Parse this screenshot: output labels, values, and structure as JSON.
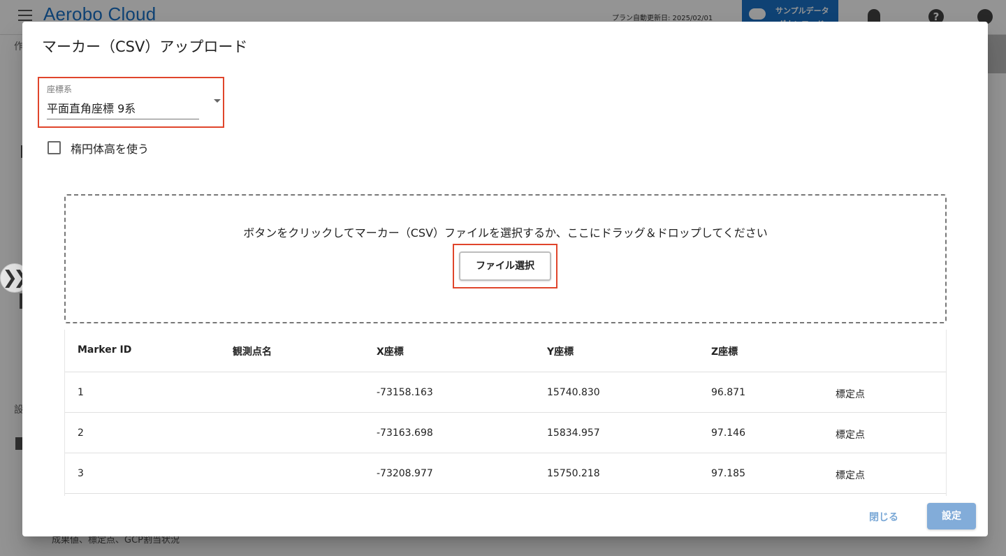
{
  "app": {
    "title": "Aerobo Cloud",
    "plan_date": "プラン自動更新日: 2025/02/01",
    "sample_button_line1": "サンプルデータ",
    "sample_button_line2": "ダウンロード",
    "bottom_text": "成果値、標定点、GCP割当状況"
  },
  "dialog": {
    "title": "マーカー（CSV）アップロード",
    "coord_select": {
      "label": "座標系",
      "value": "平面直角座標 9系"
    },
    "checkbox_label": "楕円体高を使う",
    "dropzone_text": "ボタンをクリックしてマーカー（CSV）ファイルを選択するか、ここにドラッグ＆ドロップしてください",
    "file_button": "ファイル選択",
    "table": {
      "headers": [
        "Marker ID",
        "観測点名",
        "X座標",
        "Y座標",
        "Z座標",
        ""
      ],
      "rows": [
        [
          "1",
          "",
          "-73158.163",
          "15740.830",
          "96.871",
          "標定点"
        ],
        [
          "2",
          "",
          "-73163.698",
          "15834.957",
          "97.146",
          "標定点"
        ],
        [
          "3",
          "",
          "-73208.977",
          "15750.218",
          "97.185",
          "標定点"
        ]
      ]
    },
    "close_button": "閉じる",
    "set_button": "設定"
  },
  "colors": {
    "accent": "#1a73c9",
    "highlight": "#e0452b",
    "primary_disabled": "#82acd9"
  }
}
